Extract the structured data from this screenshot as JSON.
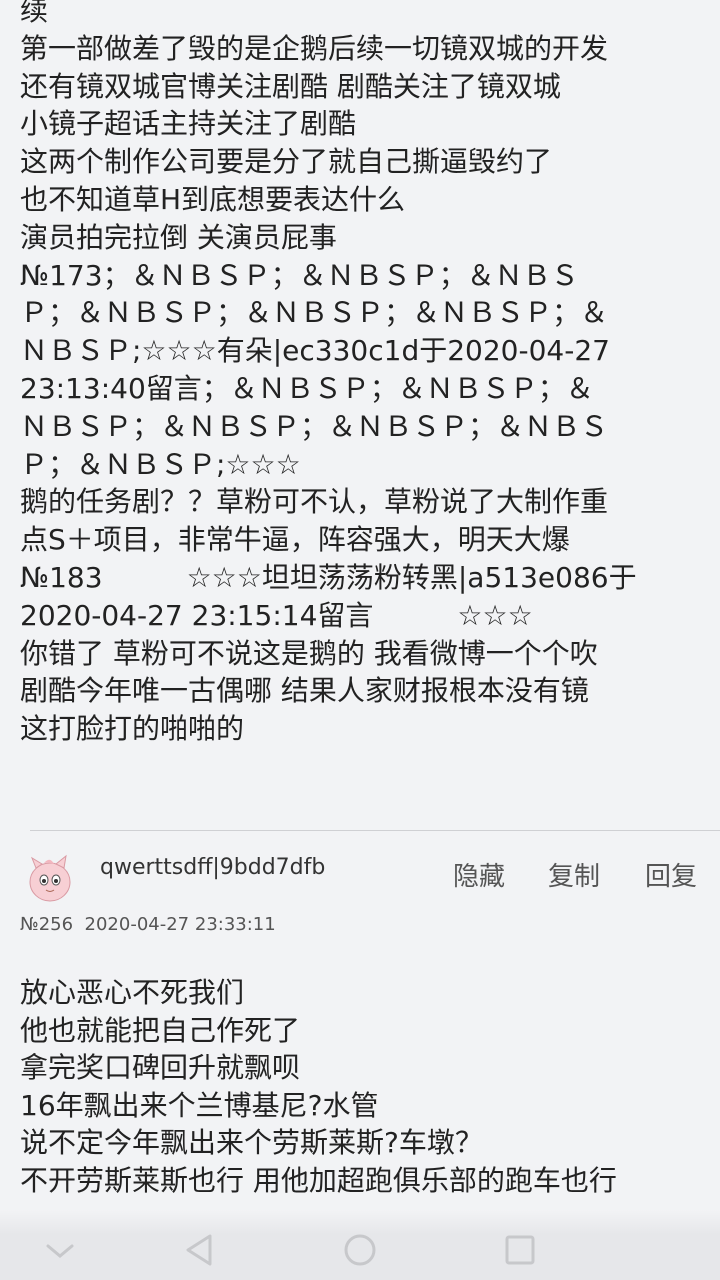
{
  "post": {
    "lines": [
      "续",
      "第一部做差了毁的是企鹅后续一切镜双城的开发",
      "还有镜双城官博关注剧酷 剧酷关注了镜双城",
      "小镜子超话主持关注了剧酷",
      "这两个制作公司要是分了就自己撕逼毁约了",
      "也不知道草H到底想要表达什么",
      "演员拍完拉倒 关演员屁事",
      "№173；＆ＮＢＳＰ；＆ＮＢＳＰ；＆ＮＢＳ",
      "Ｐ；＆ＮＢＳＰ；＆ＮＢＳＰ；＆ＮＢＳＰ；＆",
      "ＮＢＳＰ;☆☆☆有朵|ec330c1d于2020-04-27",
      "23:13:40留言；＆ＮＢＳＰ；＆ＮＢＳＰ；＆",
      "ＮＢＳＰ；＆ＮＢＳＰ；＆ＮＢＳＰ；＆ＮＢＳ",
      "Ｐ；＆ＮＢＳＰ;☆☆☆",
      "鹅的任务剧？？草粉可不认，草粉说了大制作重",
      "点S＋项目，非常牛逼，阵容强大，明天大爆",
      "№183　　　☆☆☆坦坦荡荡粉转黑|a513e086于",
      "2020-04-27 23:15:14留言　　　☆☆☆",
      "你错了 草粉可不说这是鹅的 我看微博一个个吹",
      "剧酷今年唯一古偶哪 结果人家财报根本没有镜",
      "这打脸打的啪啪的"
    ]
  },
  "reply": {
    "username": "qwerttsdff|9bdd7dfb",
    "number": "№256",
    "timestamp": "2020-04-27 23:33:11",
    "actions": {
      "hide": "隐藏",
      "copy": "复制",
      "reply": "回复"
    },
    "lines": [
      "放心恶心不死我们",
      "他也就能把自己作死了",
      "拿完奖口碑回升就飘呗",
      "16年飘出来个兰博基尼?水管",
      "说不定今年飘出来个劳斯莱斯?车墩？",
      "不开劳斯莱斯也行 用他加超跑俱乐部的跑车也行"
    ]
  },
  "navbar": {
    "icons": [
      "chevron-down-icon",
      "back-triangle-icon",
      "home-circle-icon",
      "recents-square-icon"
    ]
  },
  "colors": {
    "background": "#f2f3f5",
    "text": "#222222",
    "action": "#555555"
  }
}
